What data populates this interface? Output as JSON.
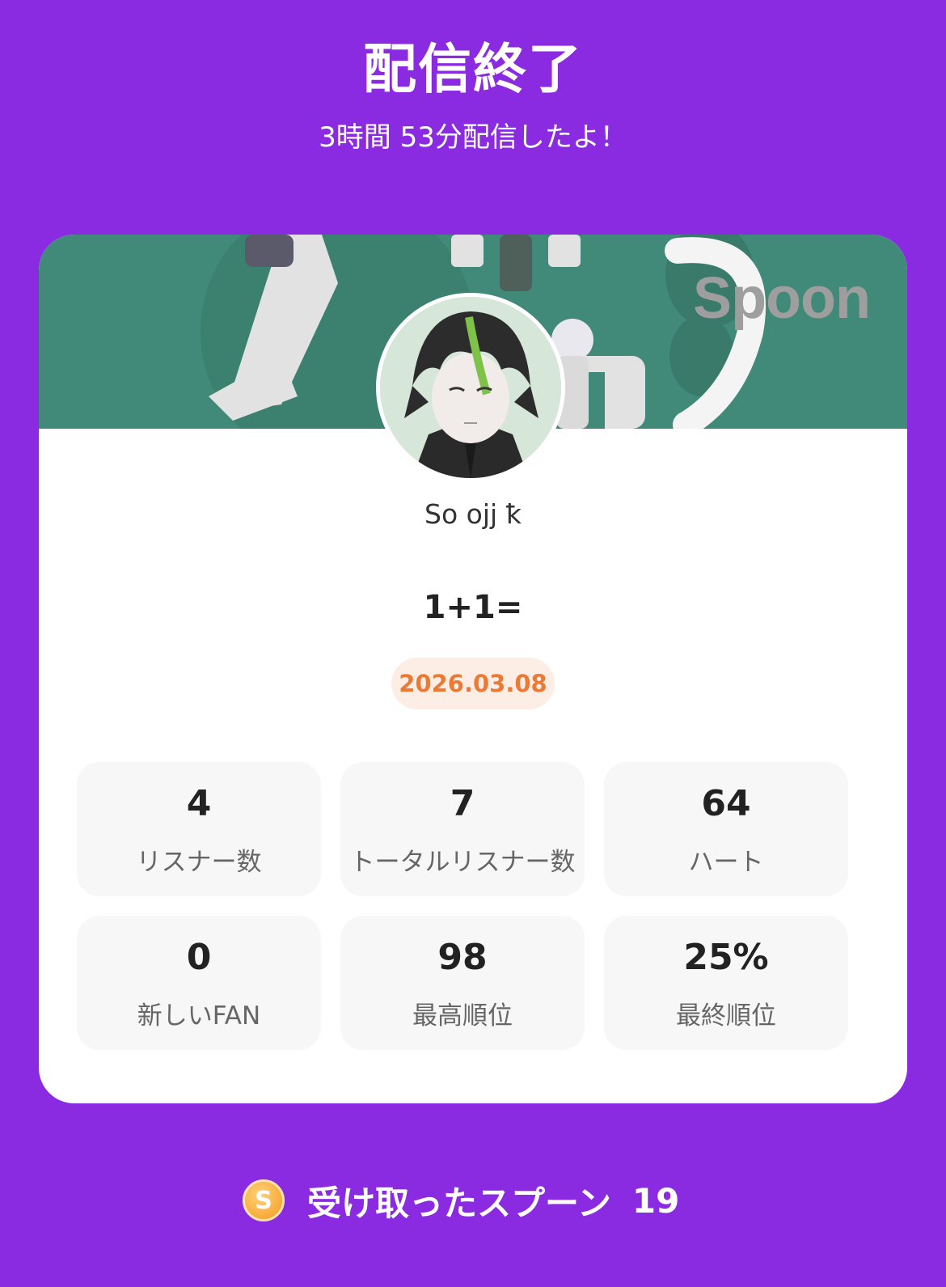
{
  "header": {
    "title": "配信終了",
    "subtitle": "3時間 53分配信したよ！"
  },
  "card": {
    "banner_brand": "Spoon",
    "username": "So ojj ꝁ",
    "live_title": "1+1=",
    "date": "2026.03.08",
    "stats": [
      {
        "value": "4",
        "label": "リスナー数"
      },
      {
        "value": "7",
        "label": "トータルリスナー数"
      },
      {
        "value": "64",
        "label": "ハート"
      },
      {
        "value": "0",
        "label": "新しいFAN"
      },
      {
        "value": "98",
        "label": "最高順位"
      },
      {
        "value": "25%",
        "label": "最終順位"
      }
    ]
  },
  "footer": {
    "coin_icon": "spoon-coin-icon",
    "coin_letter": "S",
    "label": "受け取ったスプーン",
    "count": "19"
  },
  "colors": {
    "background": "#8a2be2",
    "banner": "#418a7a",
    "date_text": "#ec7a37",
    "date_bg": "#fdeee5",
    "stat_bg": "#f7f7f7"
  }
}
